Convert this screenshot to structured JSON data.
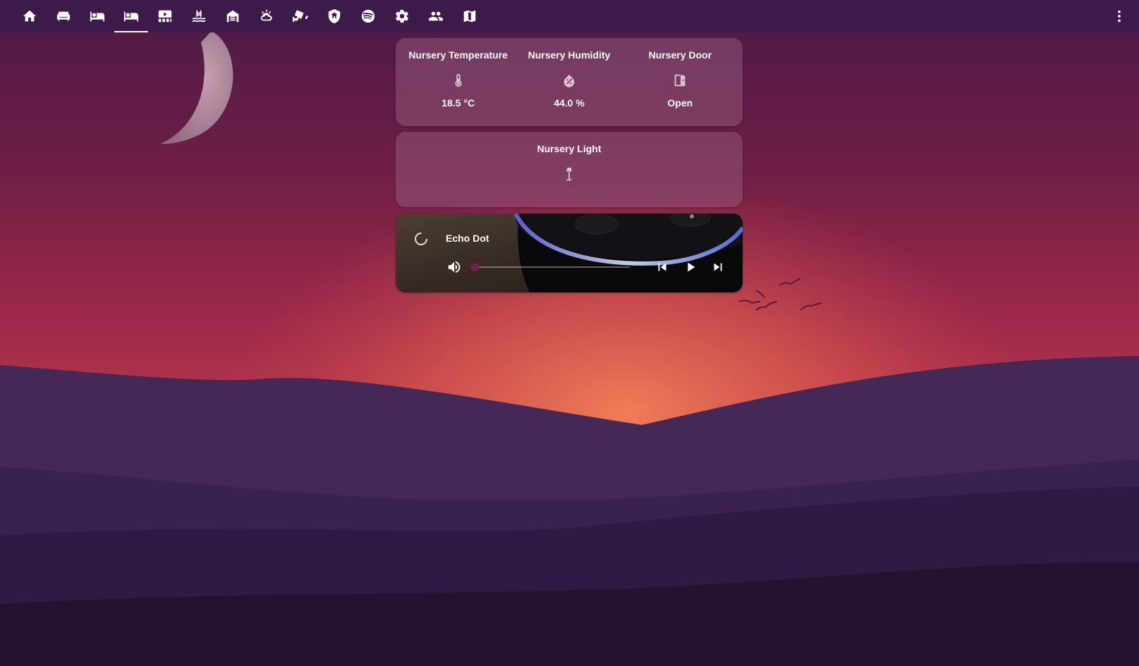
{
  "topbar": {
    "tabs": [
      {
        "icon": "home-icon",
        "active": false
      },
      {
        "icon": "sofa-icon",
        "active": false
      },
      {
        "icon": "bed-single-icon",
        "active": false
      },
      {
        "icon": "bed-icon",
        "active": true
      },
      {
        "icon": "theater-icon",
        "active": false
      },
      {
        "icon": "pool-icon",
        "active": false
      },
      {
        "icon": "garage-icon",
        "active": false
      },
      {
        "icon": "weather-icon",
        "active": false
      },
      {
        "icon": "cctv-icon",
        "active": false
      },
      {
        "icon": "shield-home-icon",
        "active": false
      },
      {
        "icon": "spotify-icon",
        "active": false
      },
      {
        "icon": "gear-icon",
        "active": false
      },
      {
        "icon": "people-icon",
        "active": false
      },
      {
        "icon": "map-icon",
        "active": false
      }
    ],
    "menu_icon": "dots-vertical-icon"
  },
  "glance": {
    "entities": [
      {
        "name": "Nursery Temperature",
        "icon": "thermometer-icon",
        "state": "18.5 °C"
      },
      {
        "name": "Nursery Humidity",
        "icon": "water-percent-icon",
        "state": "44.0 %"
      },
      {
        "name": "Nursery Door",
        "icon": "door-open-icon",
        "state": "Open"
      }
    ]
  },
  "light": {
    "name": "Nursery Light",
    "icon": "floor-lamp-icon"
  },
  "media": {
    "title": "Echo Dot",
    "volume_level": 0.0,
    "state": "loading"
  },
  "colors": {
    "topbar": "#3d1a4a",
    "accent": "#7a1d48",
    "card": "#925678"
  }
}
